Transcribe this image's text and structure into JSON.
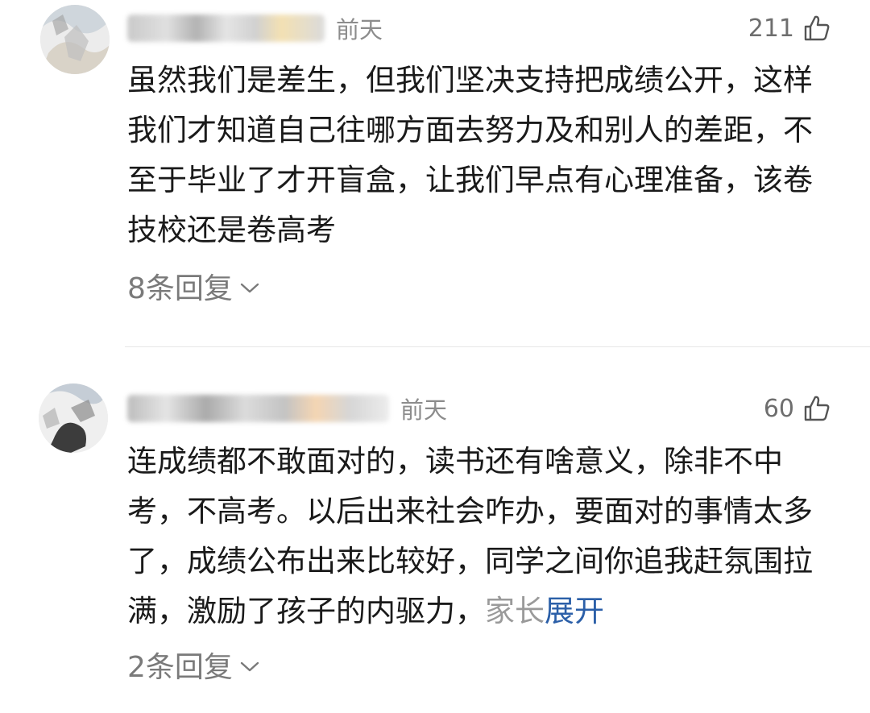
{
  "comments": [
    {
      "time": "前天",
      "likes": "211",
      "text": "虽然我们是差生，但我们坚决支持把成绩公开，这样我们才知道自己往哪方面去努力及和别人的差距，不至于毕业了才开盲盒，让我们早点有心理准备，该卷技校还是卷高考",
      "replies_label": "8条回复",
      "icons": {
        "avatar": "avatar-image",
        "like": "thumbs-up-icon",
        "expand": "chevron-down-icon"
      }
    },
    {
      "time": "前天",
      "likes": "60",
      "text_main": "连成绩都不敢面对的，读书还有啥意义，除非不中考，不高考。以后出来社会咋办，要面对的事情太多了，成绩公布出来比较好，同学之间你追我赶氛围拉满，激励了孩子的内驱力，",
      "text_fade": "家长",
      "expand_label": "展开",
      "replies_label": "2条回复",
      "icons": {
        "avatar": "avatar-image",
        "like": "thumbs-up-icon",
        "expand": "chevron-down-icon"
      }
    }
  ],
  "colors": {
    "text": "#1a1a1a",
    "meta": "#8c8c8c",
    "link": "#2b5fa8",
    "divider": "#e6e6e6"
  }
}
